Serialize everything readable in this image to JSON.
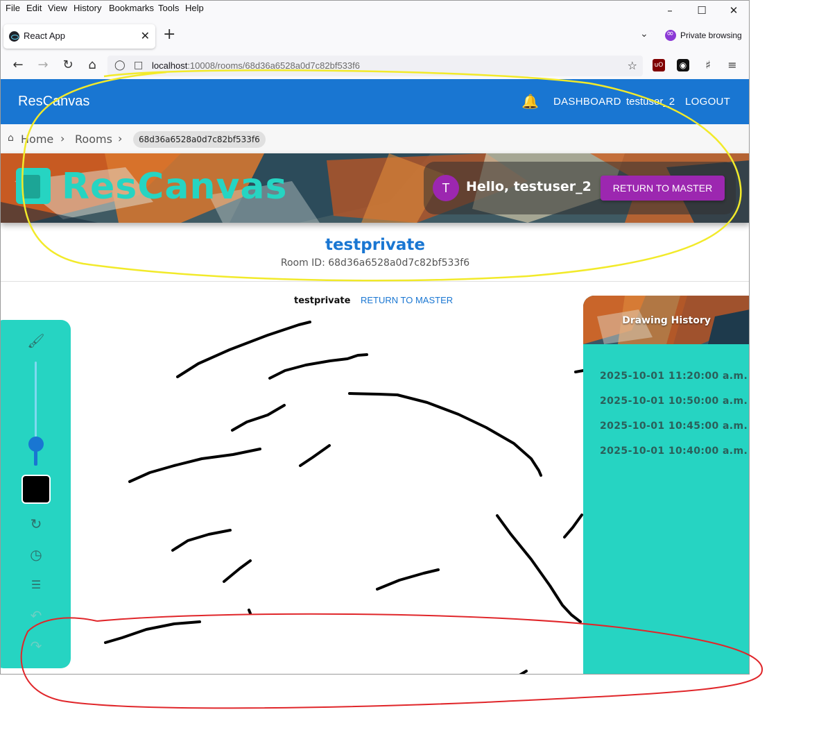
{
  "browser": {
    "menu": [
      "File",
      "Edit",
      "View",
      "History",
      "Bookmarks",
      "Tools",
      "Help"
    ],
    "tab_title": "React App",
    "private_label": "Private browsing",
    "url_host": "localhost",
    "url_rest": ":10008/rooms/68d36a6528a0d7c82bf533f6"
  },
  "appbar": {
    "brand": "ResCanvas",
    "dashboard": "DASHBOARD",
    "username": "testuser_2",
    "logout": "LOGOUT"
  },
  "breadcrumbs": {
    "home": "Home",
    "rooms": "Rooms",
    "current": "68d36a6528a0d7c82bf533f6"
  },
  "hero": {
    "logo_text": "ResCanvas",
    "avatar_initial": "T",
    "greeting": "Hello, testuser_2",
    "return_button": "RETURN TO MASTER"
  },
  "room": {
    "title": "testprivate",
    "room_id_label": "Room ID: 68d36a6528a0d7c82bf533f6"
  },
  "canvas": {
    "room_name": "testprivate",
    "return_link": "RETURN TO MASTER",
    "brush_color": "#000000"
  },
  "history": {
    "title": "Drawing History",
    "entries": [
      "2025-10-01 11:20:00 a.m.",
      "2025-10-01 10:50:00 a.m.",
      "2025-10-01 10:45:00 a.m.",
      "2025-10-01 10:40:00 a.m."
    ]
  },
  "colors": {
    "appbar": "#1976d2",
    "teal": "#26d4c2",
    "purple": "#9c27b0"
  }
}
